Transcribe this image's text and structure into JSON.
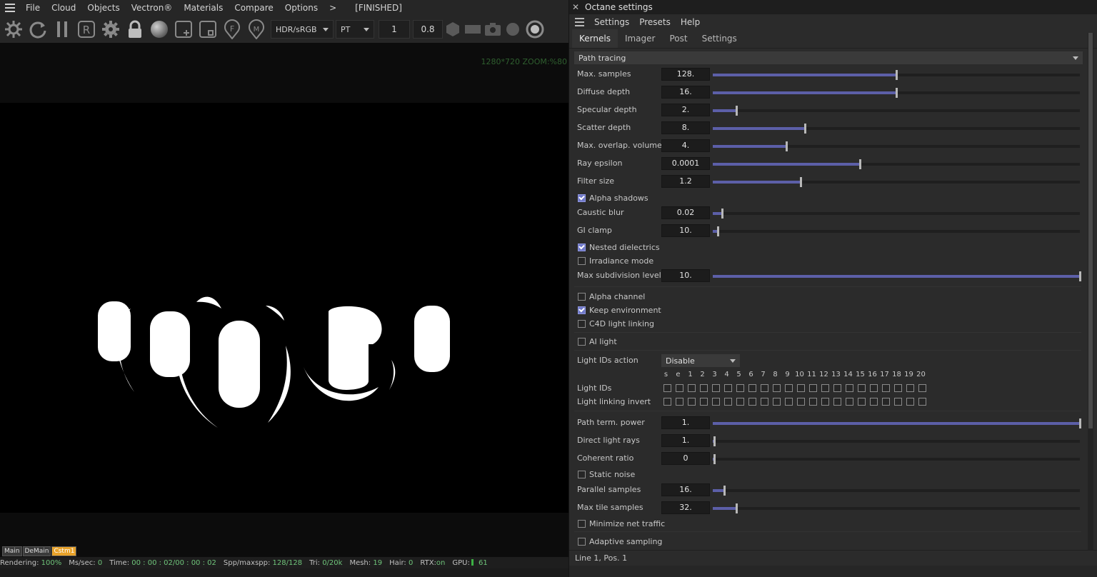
{
  "viewer": {
    "menu": [
      "File",
      "Cloud",
      "Objects",
      "Vectron®",
      "Materials",
      "Compare",
      "Options",
      ">"
    ],
    "status": "[FINISHED]",
    "toolbar": {
      "icons": [
        "octane-logo-icon",
        "refresh-icon",
        "pause-icon",
        "region-render-icon",
        "settings-gear-icon",
        "lock-icon",
        "material-ball-icon",
        "add-clay-icon",
        "focus-box-icon",
        "focus-picker-icon",
        "material-picker-icon"
      ],
      "region_letter": "R",
      "focus_letter": "F",
      "material_letter": "M",
      "color_space": "HDR/sRGB",
      "kernel": "PT",
      "number_1": "1",
      "number_2": "0.8"
    },
    "resolution_label": "1280*720 ZOOM:%80",
    "scene_tabs": [
      "Main",
      "DeMain",
      "Cstm1"
    ],
    "statusbar": {
      "rendering_label": "Rendering:",
      "rendering_value": "100%",
      "ms_label": "Ms/sec:",
      "ms_value": "0",
      "time_label": "Time:",
      "time_value": "00 : 00 : 02/00 : 00 : 02",
      "spp_label": "Spp/maxspp:",
      "spp_value": "128/128",
      "tri_label": "Tri:",
      "tri_value": "0/20k",
      "mesh_label": "Mesh:",
      "mesh_value": "19",
      "hair_label": "Hair:",
      "hair_value": "0",
      "rtx_label": "RTX:",
      "rtx_value": "on",
      "gpu_label": "GPU:",
      "gpu_value": "61"
    }
  },
  "panel": {
    "title": "Octane settings",
    "menu": [
      "Settings",
      "Presets",
      "Help"
    ],
    "tabs": [
      "Kernels",
      "Imager",
      "Post",
      "Settings"
    ],
    "active_tab": "Kernels",
    "kernel_dropdown": "Path tracing",
    "sliders_a": [
      {
        "label": "Max. samples",
        "value": "128.",
        "fill": 0.5
      },
      {
        "label": "Diffuse depth",
        "value": "16.",
        "fill": 0.5
      },
      {
        "label": "Specular depth",
        "value": "2.",
        "fill": 0.065
      },
      {
        "label": "Scatter depth",
        "value": "8.",
        "fill": 0.25
      },
      {
        "label": "Max. overlap. volumes",
        "value": "4.",
        "fill": 0.2
      },
      {
        "label": "Ray epsilon",
        "value": "0.0001",
        "fill": 0.4
      },
      {
        "label": "Filter size",
        "value": "1.2",
        "fill": 0.24
      }
    ],
    "alpha_shadows": {
      "label": "Alpha shadows",
      "checked": true
    },
    "sliders_b": [
      {
        "label": "Caustic blur",
        "value": "0.02",
        "fill": 0.025
      },
      {
        "label": "GI clamp",
        "value": "10.",
        "fill": 0.014
      }
    ],
    "nested_dielectrics": {
      "label": "Nested dielectrics",
      "checked": true
    },
    "irradiance_mode": {
      "label": "Irradiance mode",
      "checked": false
    },
    "max_subdivision": {
      "label": "Max subdivision level",
      "value": "10.",
      "fill": 1.0
    },
    "alpha_channel": {
      "label": "Alpha channel",
      "checked": false
    },
    "keep_environment": {
      "label": "Keep environment",
      "checked": true
    },
    "c4d_light_linking": {
      "label": "C4D light linking",
      "checked": false
    },
    "ai_light": {
      "label": "AI light",
      "checked": false
    },
    "light_ids_action": {
      "label": "Light IDs action",
      "value": "Disable"
    },
    "light_id_headers": [
      "s",
      "e",
      "1",
      "2",
      "3",
      "4",
      "5",
      "6",
      "7",
      "8",
      "9",
      "10",
      "11",
      "12",
      "13",
      "14",
      "15",
      "16",
      "17",
      "18",
      "19",
      "20"
    ],
    "light_ids_label": "Light IDs",
    "light_linking_invert_label": "Light linking invert",
    "sliders_c": [
      {
        "label": "Path term. power",
        "value": "1.",
        "fill": 1.0
      },
      {
        "label": "Direct light rays",
        "value": "1.",
        "fill": 0.004
      },
      {
        "label": "Coherent ratio",
        "value": "0",
        "fill": 0.004
      }
    ],
    "static_noise": {
      "label": "Static noise",
      "checked": false
    },
    "sliders_d": [
      {
        "label": "Parallel samples",
        "value": "16.",
        "fill": 0.032
      },
      {
        "label": "Max tile samples",
        "value": "32.",
        "fill": 0.064
      }
    ],
    "minimize_net_traffic": {
      "label": "Minimize net traffic",
      "checked": false
    },
    "adaptive_sampling": {
      "label": "Adaptive sampling",
      "checked": false
    },
    "status_line": "Line 1, Pos. 1"
  },
  "colors": {
    "slider_fill": "#5c5fa8",
    "checkbox_on": "#6f78c8",
    "active_scene_tab": "#e8a22a",
    "status_value": "#6fc47a"
  }
}
